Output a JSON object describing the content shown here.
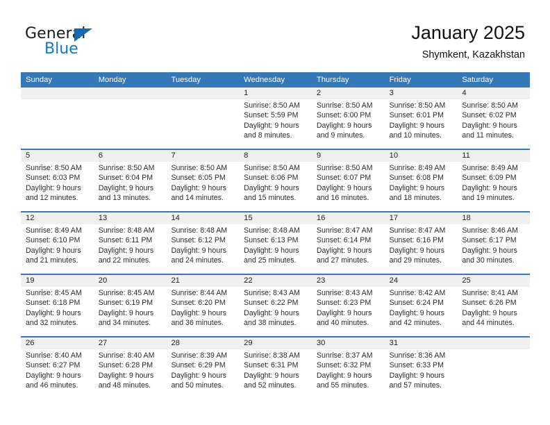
{
  "logo": {
    "word_top": "General",
    "word_bottom": "Blue",
    "triangle_color": "#1369b5",
    "blue_color": "#1378c8"
  },
  "header": {
    "title": "January 2025",
    "subtitle": "Shymkent, Kazakhstan"
  },
  "theme": {
    "header_blue": "#3478b8",
    "daynum_band": "#f0f0f0"
  },
  "weekday_headers": [
    "Sunday",
    "Monday",
    "Tuesday",
    "Wednesday",
    "Thursday",
    "Friday",
    "Saturday"
  ],
  "weeks": [
    [
      {
        "day": "",
        "lines": []
      },
      {
        "day": "",
        "lines": []
      },
      {
        "day": "",
        "lines": []
      },
      {
        "day": "1",
        "lines": [
          "Sunrise: 8:50 AM",
          "Sunset: 5:59 PM",
          "Daylight: 9 hours",
          "and 8 minutes."
        ]
      },
      {
        "day": "2",
        "lines": [
          "Sunrise: 8:50 AM",
          "Sunset: 6:00 PM",
          "Daylight: 9 hours",
          "and 9 minutes."
        ]
      },
      {
        "day": "3",
        "lines": [
          "Sunrise: 8:50 AM",
          "Sunset: 6:01 PM",
          "Daylight: 9 hours",
          "and 10 minutes."
        ]
      },
      {
        "day": "4",
        "lines": [
          "Sunrise: 8:50 AM",
          "Sunset: 6:02 PM",
          "Daylight: 9 hours",
          "and 11 minutes."
        ]
      }
    ],
    [
      {
        "day": "5",
        "lines": [
          "Sunrise: 8:50 AM",
          "Sunset: 6:03 PM",
          "Daylight: 9 hours",
          "and 12 minutes."
        ]
      },
      {
        "day": "6",
        "lines": [
          "Sunrise: 8:50 AM",
          "Sunset: 6:04 PM",
          "Daylight: 9 hours",
          "and 13 minutes."
        ]
      },
      {
        "day": "7",
        "lines": [
          "Sunrise: 8:50 AM",
          "Sunset: 6:05 PM",
          "Daylight: 9 hours",
          "and 14 minutes."
        ]
      },
      {
        "day": "8",
        "lines": [
          "Sunrise: 8:50 AM",
          "Sunset: 6:06 PM",
          "Daylight: 9 hours",
          "and 15 minutes."
        ]
      },
      {
        "day": "9",
        "lines": [
          "Sunrise: 8:50 AM",
          "Sunset: 6:07 PM",
          "Daylight: 9 hours",
          "and 16 minutes."
        ]
      },
      {
        "day": "10",
        "lines": [
          "Sunrise: 8:49 AM",
          "Sunset: 6:08 PM",
          "Daylight: 9 hours",
          "and 18 minutes."
        ]
      },
      {
        "day": "11",
        "lines": [
          "Sunrise: 8:49 AM",
          "Sunset: 6:09 PM",
          "Daylight: 9 hours",
          "and 19 minutes."
        ]
      }
    ],
    [
      {
        "day": "12",
        "lines": [
          "Sunrise: 8:49 AM",
          "Sunset: 6:10 PM",
          "Daylight: 9 hours",
          "and 21 minutes."
        ]
      },
      {
        "day": "13",
        "lines": [
          "Sunrise: 8:48 AM",
          "Sunset: 6:11 PM",
          "Daylight: 9 hours",
          "and 22 minutes."
        ]
      },
      {
        "day": "14",
        "lines": [
          "Sunrise: 8:48 AM",
          "Sunset: 6:12 PM",
          "Daylight: 9 hours",
          "and 24 minutes."
        ]
      },
      {
        "day": "15",
        "lines": [
          "Sunrise: 8:48 AM",
          "Sunset: 6:13 PM",
          "Daylight: 9 hours",
          "and 25 minutes."
        ]
      },
      {
        "day": "16",
        "lines": [
          "Sunrise: 8:47 AM",
          "Sunset: 6:14 PM",
          "Daylight: 9 hours",
          "and 27 minutes."
        ]
      },
      {
        "day": "17",
        "lines": [
          "Sunrise: 8:47 AM",
          "Sunset: 6:16 PM",
          "Daylight: 9 hours",
          "and 29 minutes."
        ]
      },
      {
        "day": "18",
        "lines": [
          "Sunrise: 8:46 AM",
          "Sunset: 6:17 PM",
          "Daylight: 9 hours",
          "and 30 minutes."
        ]
      }
    ],
    [
      {
        "day": "19",
        "lines": [
          "Sunrise: 8:45 AM",
          "Sunset: 6:18 PM",
          "Daylight: 9 hours",
          "and 32 minutes."
        ]
      },
      {
        "day": "20",
        "lines": [
          "Sunrise: 8:45 AM",
          "Sunset: 6:19 PM",
          "Daylight: 9 hours",
          "and 34 minutes."
        ]
      },
      {
        "day": "21",
        "lines": [
          "Sunrise: 8:44 AM",
          "Sunset: 6:20 PM",
          "Daylight: 9 hours",
          "and 36 minutes."
        ]
      },
      {
        "day": "22",
        "lines": [
          "Sunrise: 8:43 AM",
          "Sunset: 6:22 PM",
          "Daylight: 9 hours",
          "and 38 minutes."
        ]
      },
      {
        "day": "23",
        "lines": [
          "Sunrise: 8:43 AM",
          "Sunset: 6:23 PM",
          "Daylight: 9 hours",
          "and 40 minutes."
        ]
      },
      {
        "day": "24",
        "lines": [
          "Sunrise: 8:42 AM",
          "Sunset: 6:24 PM",
          "Daylight: 9 hours",
          "and 42 minutes."
        ]
      },
      {
        "day": "25",
        "lines": [
          "Sunrise: 8:41 AM",
          "Sunset: 6:26 PM",
          "Daylight: 9 hours",
          "and 44 minutes."
        ]
      }
    ],
    [
      {
        "day": "26",
        "lines": [
          "Sunrise: 8:40 AM",
          "Sunset: 6:27 PM",
          "Daylight: 9 hours",
          "and 46 minutes."
        ]
      },
      {
        "day": "27",
        "lines": [
          "Sunrise: 8:40 AM",
          "Sunset: 6:28 PM",
          "Daylight: 9 hours",
          "and 48 minutes."
        ]
      },
      {
        "day": "28",
        "lines": [
          "Sunrise: 8:39 AM",
          "Sunset: 6:29 PM",
          "Daylight: 9 hours",
          "and 50 minutes."
        ]
      },
      {
        "day": "29",
        "lines": [
          "Sunrise: 8:38 AM",
          "Sunset: 6:31 PM",
          "Daylight: 9 hours",
          "and 52 minutes."
        ]
      },
      {
        "day": "30",
        "lines": [
          "Sunrise: 8:37 AM",
          "Sunset: 6:32 PM",
          "Daylight: 9 hours",
          "and 55 minutes."
        ]
      },
      {
        "day": "31",
        "lines": [
          "Sunrise: 8:36 AM",
          "Sunset: 6:33 PM",
          "Daylight: 9 hours",
          "and 57 minutes."
        ]
      },
      {
        "day": "",
        "lines": []
      }
    ]
  ]
}
